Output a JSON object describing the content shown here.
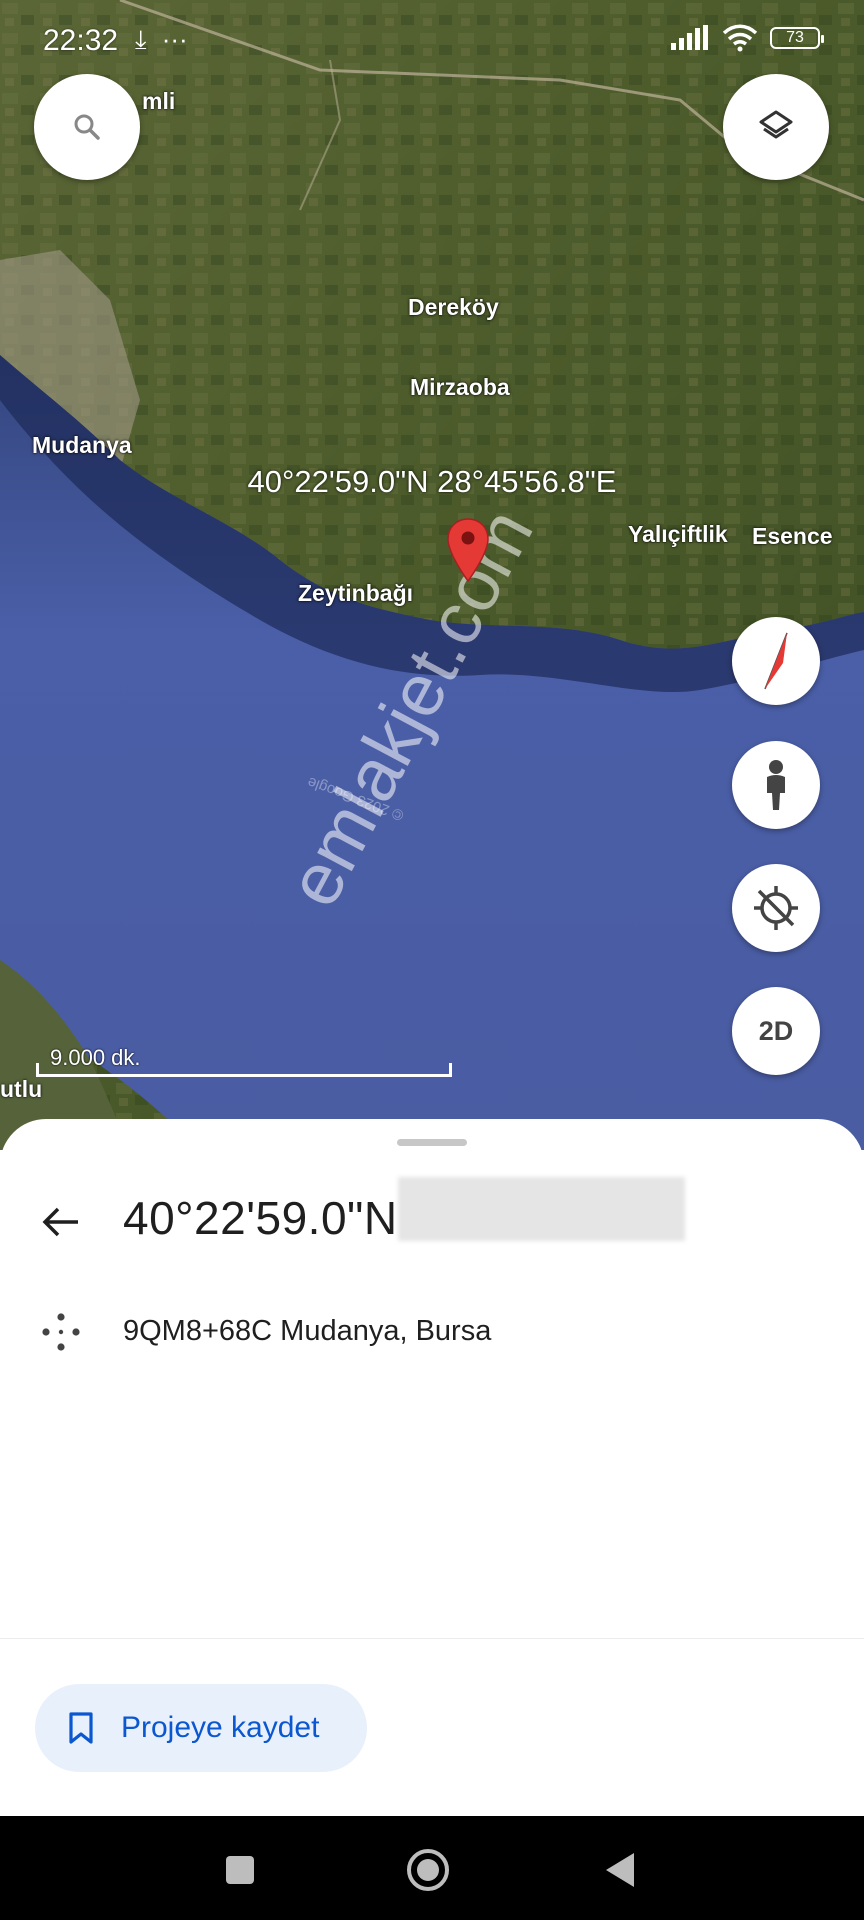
{
  "status_bar": {
    "time": "22:32",
    "battery": "73",
    "left_icons": [
      "download-icon",
      "more-dots-icon"
    ],
    "right_icons": [
      "signal-icon",
      "wifi-icon",
      "battery-icon"
    ]
  },
  "map": {
    "places": [
      "mli",
      "Dereköy",
      "Mirzaoba",
      "Mudanya",
      "Yalıçiftlik",
      "Esence",
      "Zeytinbağı",
      "utlu"
    ],
    "selected_coordinates": "40°22'59.0\"N 28°45'56.8\"E",
    "scale_label": "9.000 dk.",
    "watermark": "emlakjet.com",
    "copyright": "© 2023 Google"
  },
  "controls": {
    "search_icon": "search-icon",
    "layers_icon": "layers-icon",
    "compass_icon": "compass-icon",
    "street_view_icon": "pegman-icon",
    "location_icon": "location-off-icon",
    "view_mode": "2D"
  },
  "sheet": {
    "title": "40°22'59.0\"N",
    "plus_code": "9QM8+68C Mudanya, Bursa",
    "save_button": "Projeye kaydet"
  },
  "colors": {
    "accent": "#0b57d0",
    "save_button_bg": "#e8f0fb",
    "pin": "#e53935",
    "sea": "#4a5fa8"
  }
}
